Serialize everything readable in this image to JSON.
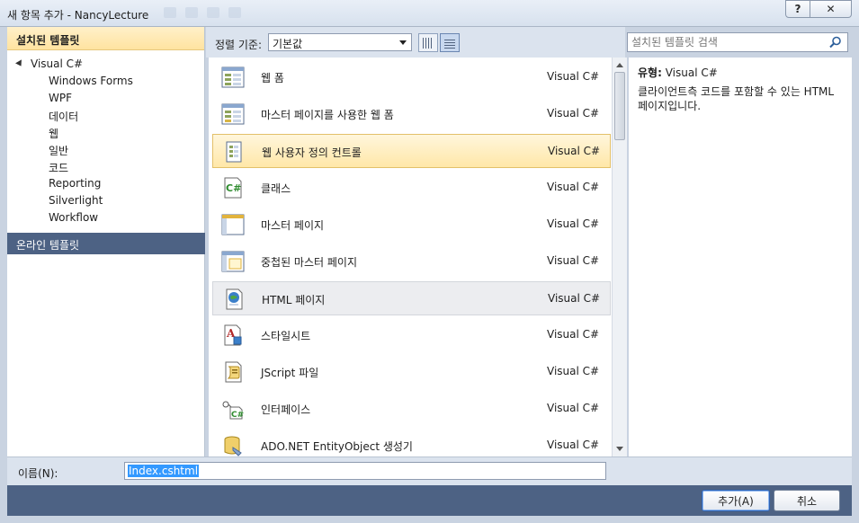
{
  "window": {
    "title": "새 항목 추가 - NancyLecture",
    "help_label": "?",
    "close_label": "✕"
  },
  "left_pane": {
    "header": "설치된 템플릿",
    "root": "Visual C#",
    "children": [
      "Windows Forms",
      "WPF",
      "데이터",
      "웹",
      "일반",
      "코드",
      "Reporting",
      "Silverlight",
      "Workflow"
    ],
    "online": "온라인 템플릿"
  },
  "toolbar": {
    "sort_label": "정렬 기준:",
    "sort_value": "기본값"
  },
  "search": {
    "placeholder": "설치된 템플릿 검색"
  },
  "templates": [
    {
      "name": "웹 폼",
      "lang": "Visual C#",
      "icon": "web-form-icon"
    },
    {
      "name": "마스터 페이지를 사용한 웹 폼",
      "lang": "Visual C#",
      "icon": "web-form-master-icon"
    },
    {
      "name": "웹 사용자 정의 컨트롤",
      "lang": "Visual C#",
      "icon": "user-control-icon"
    },
    {
      "name": "클래스",
      "lang": "Visual C#",
      "icon": "class-icon"
    },
    {
      "name": "마스터 페이지",
      "lang": "Visual C#",
      "icon": "master-page-icon"
    },
    {
      "name": "중첩된 마스터 페이지",
      "lang": "Visual C#",
      "icon": "nested-master-icon"
    },
    {
      "name": "HTML 페이지",
      "lang": "Visual C#",
      "icon": "html-page-icon"
    },
    {
      "name": "스타일시트",
      "lang": "Visual C#",
      "icon": "stylesheet-icon"
    },
    {
      "name": "JScript 파일",
      "lang": "Visual C#",
      "icon": "jscript-file-icon"
    },
    {
      "name": "인터페이스",
      "lang": "Visual C#",
      "icon": "interface-icon"
    },
    {
      "name": "ADO.NET EntityObject 생성기",
      "lang": "Visual C#",
      "icon": "entityobject-generator-icon"
    }
  ],
  "info": {
    "type_label": "유형:",
    "type_value": "Visual C#",
    "description": "클라이언트측 코드를 포함할 수 있는 HTML 페이지입니다."
  },
  "name_field": {
    "label": "이름(N):",
    "value": "Index.cshtml"
  },
  "buttons": {
    "ok": "추가(A)",
    "cancel": "취소"
  },
  "colors": {
    "selected_row": "#ffe7a8",
    "panel_header": "#ffe3a0",
    "footer": "#4d6284",
    "chrome": "#dbe3ee"
  }
}
